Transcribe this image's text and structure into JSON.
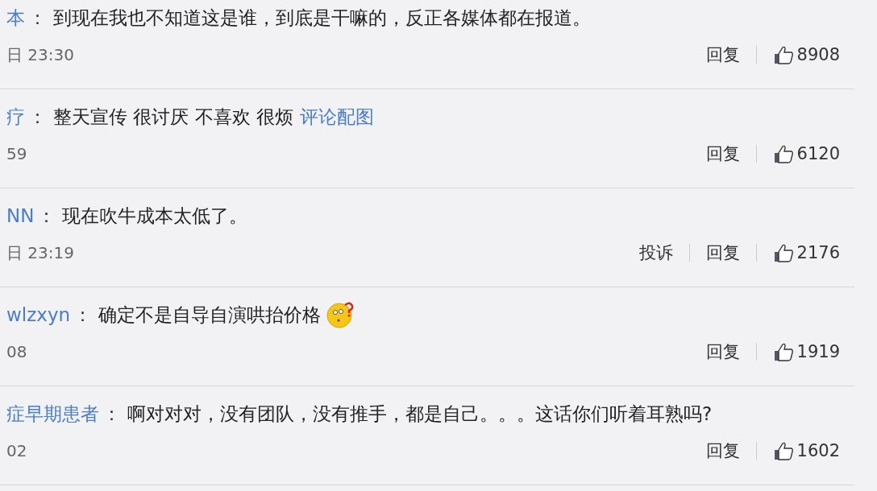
{
  "comments": [
    {
      "user": "本",
      "separator": "：",
      "text": "到现在我也不知道这是谁，到底是干嘛的，反正各媒体都在报道。",
      "emoji": false,
      "time": "日 23:30",
      "actions": [
        "回复"
      ],
      "likes": "8908"
    },
    {
      "user": "疗",
      "separator": "：",
      "text": "整天宣传 很讨厌 不喜欢 很烦",
      "link": "评论配图",
      "emoji": false,
      "time": "59",
      "actions": [
        "回复"
      ],
      "likes": "6120"
    },
    {
      "user": "NN",
      "separator": "：",
      "text": "现在吹牛成本太低了。",
      "emoji": false,
      "time": "日 23:19",
      "actions": [
        "投诉",
        "回复"
      ],
      "likes": "2176"
    },
    {
      "user": "wlzxyn",
      "separator": "：",
      "text": "确定不是自导自演哄抬价格",
      "emoji": true,
      "time": "08",
      "actions": [
        "回复"
      ],
      "likes": "1919"
    },
    {
      "user": "症早期患者",
      "separator": "：",
      "text": "啊对对对，没有团队，没有推手，都是自己。。。这话你们听着耳熟吗?",
      "emoji": false,
      "time": "02",
      "actions": [
        "回复"
      ],
      "likes": "1602"
    }
  ]
}
